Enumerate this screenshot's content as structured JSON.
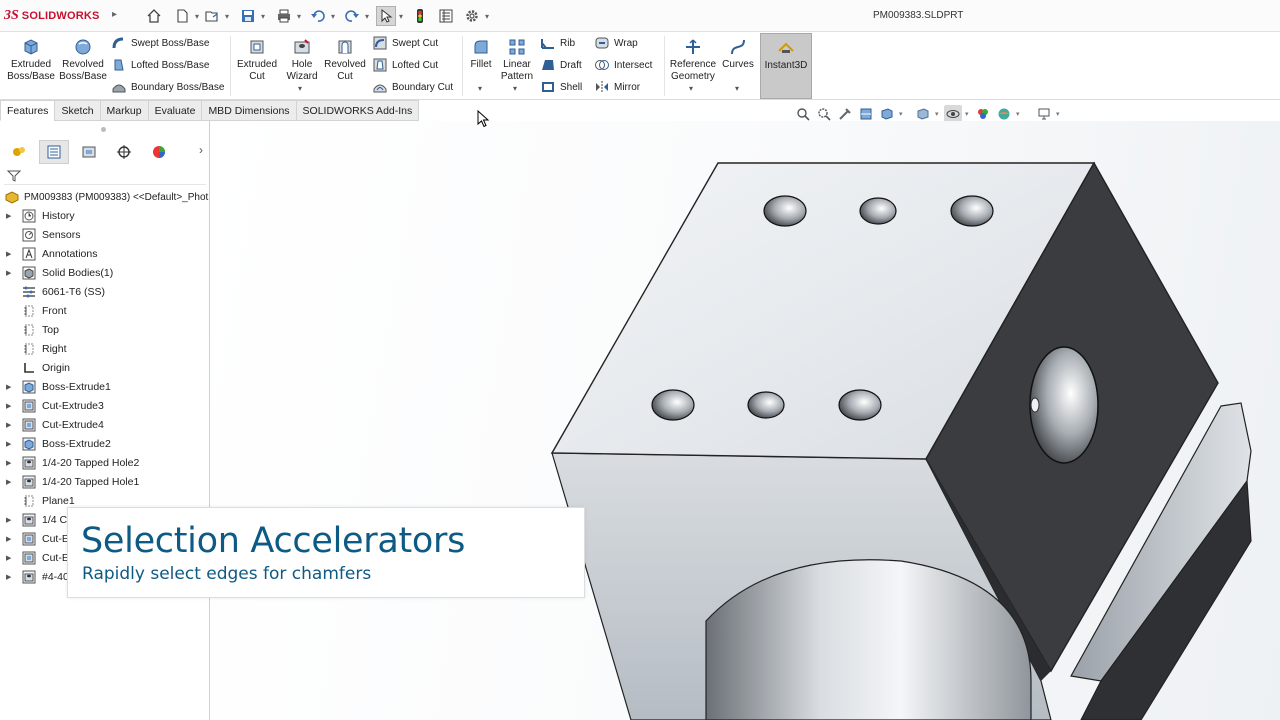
{
  "app": {
    "brand": "SOLIDWORKS",
    "logo_mark": "3S",
    "filename": "PM009383.SLDPRT"
  },
  "quick_access": {
    "icons": [
      "home-icon",
      "new-icon",
      "open-icon",
      "save-icon",
      "print-icon",
      "undo-icon",
      "redo-icon",
      "select-icon",
      "rebuild-icon",
      "file-properties-icon",
      "options-icon"
    ]
  },
  "ribbon": {
    "extruded_boss": "Extruded\nBoss/Base",
    "revolved_boss": "Revolved\nBoss/Base",
    "swept_boss": "Swept Boss/Base",
    "lofted_boss": "Lofted Boss/Base",
    "boundary_boss": "Boundary Boss/Base",
    "extruded_cut": "Extruded\nCut",
    "hole_wizard": "Hole\nWizard",
    "revolved_cut": "Revolved\nCut",
    "swept_cut": "Swept Cut",
    "lofted_cut": "Lofted Cut",
    "boundary_cut": "Boundary Cut",
    "fillet": "Fillet",
    "linear_pattern": "Linear\nPattern",
    "rib": "Rib",
    "draft": "Draft",
    "shell": "Shell",
    "wrap": "Wrap",
    "intersect": "Intersect",
    "mirror": "Mirror",
    "reference_geometry": "Reference\nGeometry",
    "curves": "Curves",
    "instant3d": "Instant3D"
  },
  "tabs": [
    "Features",
    "Sketch",
    "Markup",
    "Evaluate",
    "MBD Dimensions",
    "SOLIDWORKS Add-Ins"
  ],
  "active_tab": "Features",
  "feature_tree": {
    "root": "PM009383 (PM009383) <<Default>_Phot",
    "items": [
      {
        "label": "History",
        "icon": "history-icon",
        "expandable": true
      },
      {
        "label": "Sensors",
        "icon": "sensors-icon",
        "expandable": false
      },
      {
        "label": "Annotations",
        "icon": "annotations-icon",
        "expandable": true
      },
      {
        "label": "Solid Bodies(1)",
        "icon": "solid-bodies-icon",
        "expandable": true
      },
      {
        "label": "6061-T6 (SS)",
        "icon": "material-icon",
        "expandable": false
      },
      {
        "label": "Front",
        "icon": "plane-icon",
        "expandable": false
      },
      {
        "label": "Top",
        "icon": "plane-icon",
        "expandable": false
      },
      {
        "label": "Right",
        "icon": "plane-icon",
        "expandable": false
      },
      {
        "label": "Origin",
        "icon": "origin-icon",
        "expandable": false
      },
      {
        "label": "Boss-Extrude1",
        "icon": "extrude-icon",
        "expandable": true
      },
      {
        "label": "Cut-Extrude3",
        "icon": "cut-extrude-icon",
        "expandable": true
      },
      {
        "label": "Cut-Extrude4",
        "icon": "cut-extrude-icon",
        "expandable": true
      },
      {
        "label": "Boss-Extrude2",
        "icon": "extrude-icon",
        "expandable": true
      },
      {
        "label": "1/4-20 Tapped Hole2",
        "icon": "hole-icon",
        "expandable": true
      },
      {
        "label": "1/4-20 Tapped Hole1",
        "icon": "hole-icon",
        "expandable": true
      },
      {
        "label": "Plane1",
        "icon": "plane-icon",
        "expandable": false
      },
      {
        "label": "1/4 C",
        "icon": "hole-icon",
        "expandable": true
      },
      {
        "label": "Cut-E",
        "icon": "cut-extrude-icon",
        "expandable": true
      },
      {
        "label": "Cut-E",
        "icon": "cut-extrude-icon",
        "expandable": true
      },
      {
        "label": "#4-40",
        "icon": "hole-icon",
        "expandable": true
      }
    ]
  },
  "caption": {
    "title": "Selection Accelerators",
    "subtitle": "Rapidly select edges for chamfers"
  },
  "colors": {
    "brand_red": "#c8102e",
    "caption_blue": "#0d5a84",
    "part_top": "#e9ecef",
    "part_dark_face": "#3a3c3f"
  }
}
